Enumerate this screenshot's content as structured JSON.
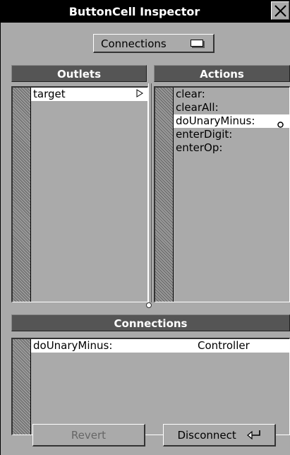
{
  "window": {
    "title": "ButtonCell Inspector"
  },
  "dropdown": {
    "label": "Connections"
  },
  "outlets": {
    "header": "Outlets",
    "items": [
      {
        "label": "target",
        "selected": true
      }
    ]
  },
  "actions": {
    "header": "Actions",
    "items": [
      {
        "label": "clear:",
        "selected": false
      },
      {
        "label": "clearAll:",
        "selected": false
      },
      {
        "label": "doUnaryMinus:",
        "selected": true
      },
      {
        "label": "enterDigit:",
        "selected": false
      },
      {
        "label": "enterOp:",
        "selected": false
      }
    ]
  },
  "connections": {
    "header": "Connections",
    "rows": [
      {
        "action": "doUnaryMinus:",
        "target": "Controller"
      }
    ]
  },
  "buttons": {
    "revert": "Revert",
    "disconnect": "Disconnect"
  },
  "icons": {
    "close": "close-icon",
    "popup": "popup-menu-icon",
    "outlet_arrow": "triangle-right-icon",
    "connected_marker": "connected-dot-icon",
    "return": "return-key-icon"
  }
}
